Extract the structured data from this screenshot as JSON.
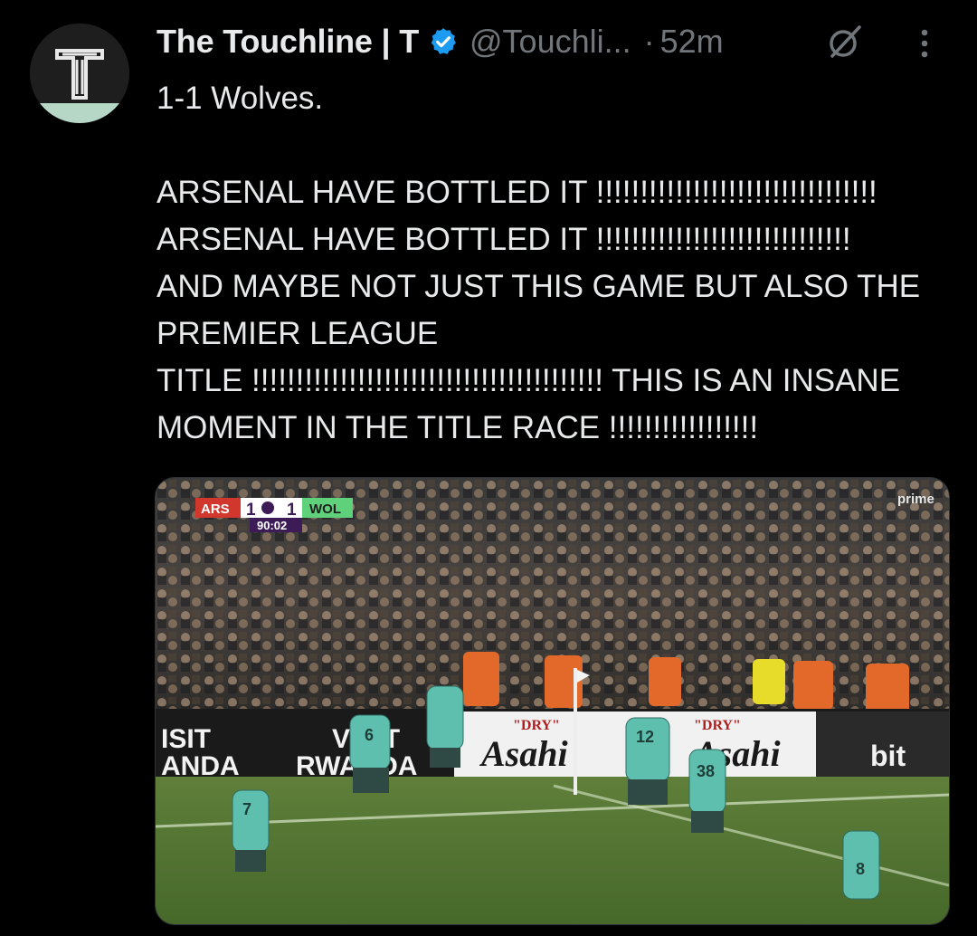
{
  "author": {
    "name": "The Touchline | T",
    "handle": "@Touchli...",
    "separator": "·",
    "time": "52m",
    "avatar_letter": "T",
    "icons": [
      "verified-badge-icon",
      "grok-icon",
      "more-icon"
    ],
    "colors": {
      "verified": "#1d9bf0",
      "secondary_text": "#71767b"
    }
  },
  "tweet": {
    "text": "1-1 Wolves.\n\nARSENAL HAVE BOTTLED IT !!!!!!!!!!!!!!!!!!!!!!!!!!!!!!!!\nARSENAL HAVE BOTTLED IT !!!!!!!!!!!!!!!!!!!!!!!!!!!!!\nAND MAYBE NOT JUST THIS GAME BUT ALSO THE PREMIER LEAGUE\nTITLE !!!!!!!!!!!!!!!!!!!!!!!!!!!!!!!!!!!!!!!! THIS IS AN INSANE MOMENT IN THE TITLE RACE !!!!!!!!!!!!!!!!!"
  },
  "media": {
    "scorebug": {
      "home": "ARS",
      "home_score": "1",
      "away_score": "1",
      "away": "WOL",
      "clock": "90:02"
    },
    "broadcaster": "prime",
    "boards": {
      "left": "ISIT\nANDA",
      "center": "VISIT\nRWANDA",
      "brand_tag": "\"DRY\"",
      "brand": "Asahi",
      "right": "bit"
    },
    "shirt_numbers": [
      "6",
      "12",
      "38",
      "8",
      "7"
    ]
  }
}
